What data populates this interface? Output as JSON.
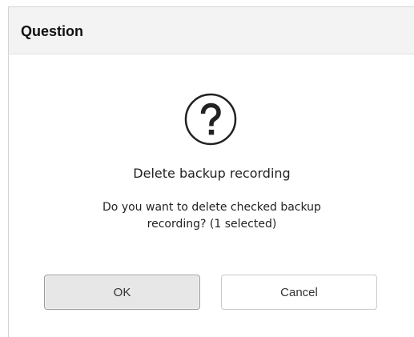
{
  "dialog": {
    "title": "Question",
    "icon": "question-circle-icon",
    "heading": "Delete backup recording",
    "message_line1": "Do you want to delete checked backup",
    "message_line2": "recording? (1 selected)",
    "buttons": {
      "ok_label": "OK",
      "cancel_label": "Cancel"
    }
  },
  "colors": {
    "titlebar_bg": "#f3f3f3",
    "ok_button_bg": "#e7e7e7",
    "cancel_button_bg": "#ffffff",
    "text": "#222222"
  }
}
